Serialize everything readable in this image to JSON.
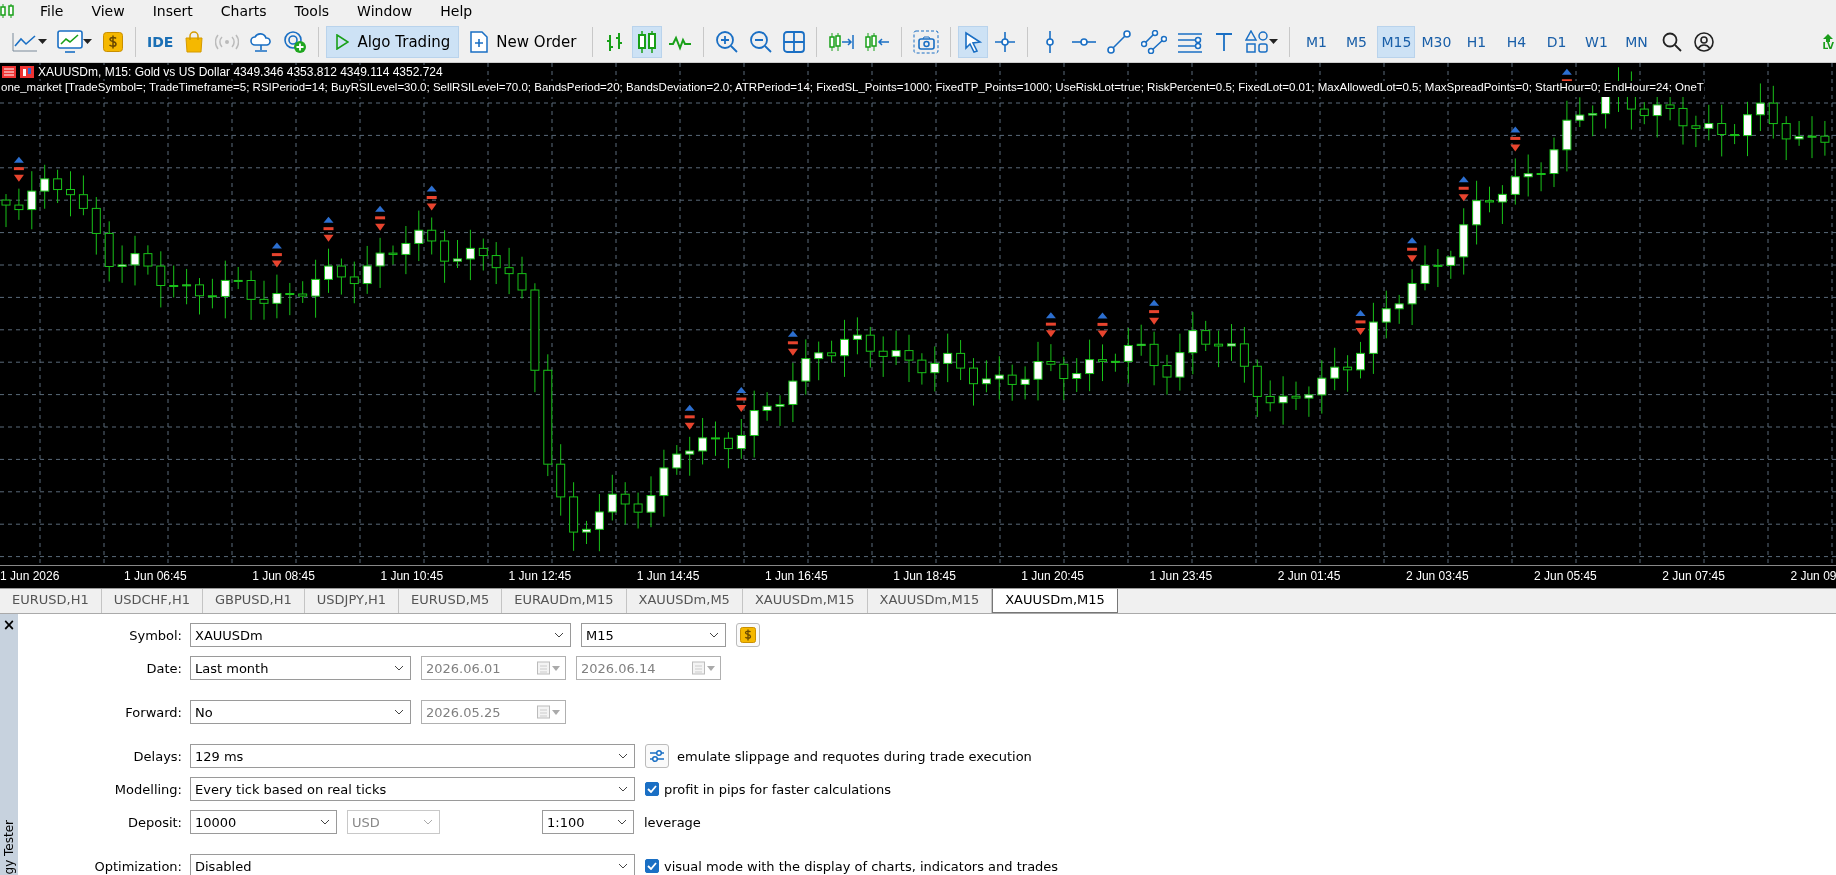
{
  "menu": [
    {
      "label": "File"
    },
    {
      "label": "View"
    },
    {
      "label": "Insert"
    },
    {
      "label": "Charts"
    },
    {
      "label": "Tools"
    },
    {
      "label": "Window"
    },
    {
      "label": "Help"
    }
  ],
  "toolbar": {
    "ide_label": "IDE",
    "algo_trading": {
      "label": "Algo Trading",
      "on": true
    },
    "new_order": {
      "label": "New Order"
    },
    "chart_types": [
      {
        "selected": false
      },
      {
        "selected": true
      },
      {
        "selected": false
      }
    ],
    "drawing_tools": [
      {
        "selected": true
      },
      {
        "selected": false
      },
      {
        "selected": false
      },
      {
        "selected": false
      },
      {
        "selected": false
      },
      {
        "selected": false
      },
      {
        "selected": false
      },
      {
        "selected": false
      },
      {
        "selected": false
      }
    ],
    "timeframes": [
      {
        "label": "M1",
        "selected": false
      },
      {
        "label": "M5",
        "selected": false
      },
      {
        "label": "M15",
        "selected": true
      },
      {
        "label": "M30",
        "selected": false
      },
      {
        "label": "H1",
        "selected": false
      },
      {
        "label": "H4",
        "selected": false
      },
      {
        "label": "D1",
        "selected": false
      },
      {
        "label": "W1",
        "selected": false
      },
      {
        "label": "MN",
        "selected": false
      }
    ],
    "badge": "LV"
  },
  "chart": {
    "symbol_line": "XAUUSDm, M15:  Gold vs US Dollar  4349.346 4353.812 4349.114 4352.724",
    "ea_line": "one_market [TradeSymbol=; TradeTimeframe=5; RSIPeriod=14; BuyRSILevel=30.0; SellRSILevel=70.0; BandsPeriod=20; BandsDeviation=2.0; ATRPeriod=14; FixedSL_Points=1000; FixedTP_Points=1000; UseRiskLot=true; RiskPercent=0.5; FixedLot=0.01; MaxAllowedLot=0.5; MaxSpreadPoints=0; StartHour=0; EndHour=24; OneT",
    "time_labels": [
      "1 Jun 2026",
      "1 Jun 06:45",
      "1 Jun 08:45",
      "1 Jun 10:45",
      "1 Jun 12:45",
      "1 Jun 14:45",
      "1 Jun 16:45",
      "1 Jun 18:45",
      "1 Jun 20:45",
      "1 Jun 23:45",
      "2 Jun 01:45",
      "2 Jun 03:45",
      "2 Jun 05:45",
      "2 Jun 07:45",
      "2 Jun 09"
    ]
  },
  "chart_tabs": [
    {
      "label": "EURUSD,H1",
      "selected": false
    },
    {
      "label": "USDCHF,H1",
      "selected": false
    },
    {
      "label": "GBPUSD,H1",
      "selected": false
    },
    {
      "label": "USDJPY,H1",
      "selected": false
    },
    {
      "label": "EURUSD,M5",
      "selected": false
    },
    {
      "label": "EURAUDm,M15",
      "selected": false
    },
    {
      "label": "XAUUSDm,M5",
      "selected": false
    },
    {
      "label": "XAUUSDm,M15",
      "selected": false
    },
    {
      "label": "XAUUSDm,M15",
      "selected": false
    },
    {
      "label": "XAUUSDm,M15",
      "selected": true
    }
  ],
  "tester": {
    "title": "gy Tester",
    "close": "×",
    "groups": [
      [
        {
          "label": "Symbol:",
          "controls": [
            {
              "kind": "select",
              "value": "XAUUSDm",
              "disabled": false
            },
            {
              "kind": "select",
              "value": "M15",
              "disabled": false
            },
            {
              "kind": "symbol-button"
            }
          ]
        },
        {
          "label": "Date:",
          "controls": [
            {
              "kind": "select",
              "value": "Last month",
              "disabled": false
            },
            {
              "kind": "date",
              "value": "2026.06.01",
              "disabled": true
            },
            {
              "kind": "date",
              "value": "2026.06.14",
              "disabled": true
            }
          ]
        }
      ],
      [
        {
          "label": "Forward:",
          "controls": [
            {
              "kind": "select",
              "value": "No",
              "disabled": false
            },
            {
              "kind": "date",
              "value": "2026.05.25",
              "disabled": true
            }
          ]
        }
      ],
      [
        {
          "label": "Delays:",
          "controls": [
            {
              "kind": "select",
              "value": "129 ms",
              "disabled": false
            },
            {
              "kind": "settings-button"
            },
            {
              "kind": "text",
              "value": "emulate slippage and requotes during trade execution"
            }
          ]
        },
        {
          "label": "Modelling:",
          "controls": [
            {
              "kind": "select",
              "value": "Every tick based on real ticks",
              "disabled": false
            },
            {
              "kind": "checkbox",
              "value": "profit in pips for faster calculations",
              "checked": true
            }
          ]
        },
        {
          "label": "Deposit:",
          "controls": [
            {
              "kind": "select",
              "value": "10000",
              "disabled": false
            },
            {
              "kind": "select",
              "value": "USD",
              "disabled": true
            },
            {
              "kind": "select",
              "value": "1:100",
              "disabled": false
            },
            {
              "kind": "text",
              "value": "leverage"
            }
          ]
        }
      ],
      [
        {
          "label": "Optimization:",
          "controls": [
            {
              "kind": "select",
              "value": "Disabled",
              "disabled": false
            },
            {
              "kind": "checkbox",
              "value": "visual mode with the display of charts, indicators and trades",
              "checked": true
            }
          ]
        }
      ]
    ]
  }
}
